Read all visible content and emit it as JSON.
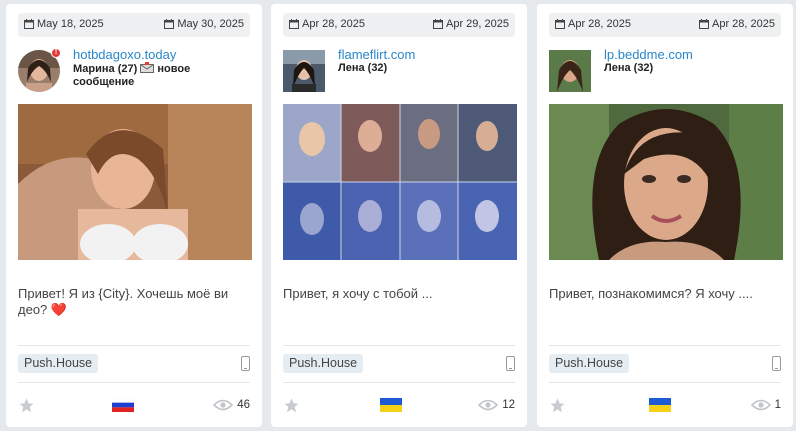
{
  "cards": [
    {
      "start_date": "May 18, 2025",
      "end_date": "May 30, 2025",
      "domain": "hotbdagoxo.today",
      "user_name": "Марина (27)",
      "user_suffix": "новое сообщение",
      "notification": "!",
      "message": "Привет! Я из {City}. Хочешь моё ви део? ❤️",
      "network": "Push.House",
      "device_icon": "mobile-phone-icon",
      "country_flag": "russia-flag",
      "views": "46"
    },
    {
      "start_date": "Apr 28, 2025",
      "end_date": "Apr 29, 2025",
      "domain": "flameflirt.com",
      "user_name": "Лена (32)",
      "message": "Привет, я хочу с тобой ...",
      "network": "Push.House",
      "device_icon": "mobile-phone-icon",
      "country_flag": "ukraine-flag",
      "views": "12"
    },
    {
      "start_date": "Apr 28, 2025",
      "end_date": "Apr 28, 2025",
      "domain": "lp.beddme.com",
      "user_name": "Лена (32)",
      "message": "Привет, познакомимся? Я хочу ....",
      "network": "Push.House",
      "device_icon": "mobile-phone-icon",
      "country_flag": "ukraine-flag",
      "views": "1"
    }
  ],
  "colors": {
    "link": "#2a86c9",
    "badge_bg": "#e5edf3",
    "page_bg": "#e6e9ec",
    "notification": "#e53935"
  }
}
